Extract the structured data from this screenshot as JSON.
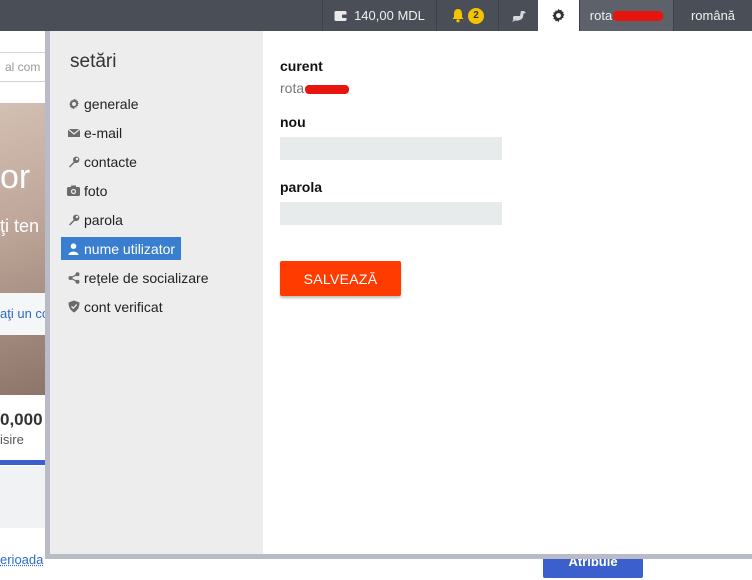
{
  "topbar": {
    "balance": "140,00 MDL",
    "notifications_count": "2",
    "user_prefix": "rota",
    "language": "română",
    "icons": [
      "wallet-icon",
      "bell-icon",
      "bird-icon",
      "gear-icon"
    ]
  },
  "background": {
    "search_placeholder": "al com",
    "hero_big": "or",
    "hero_sub": "ţi ten",
    "hero_link": "aţi un co",
    "price": "0,000 .",
    "label": "isire",
    "periods_link": "erioada",
    "button": "Atribuie"
  },
  "settings": {
    "title": "setări",
    "nav": [
      {
        "label": "generale",
        "icon": "gear-icon"
      },
      {
        "label": "e-mail",
        "icon": "envelope-icon"
      },
      {
        "label": "contacte",
        "icon": "wrench-icon"
      },
      {
        "label": "foto",
        "icon": "camera-icon"
      },
      {
        "label": "parola",
        "icon": "wrench-icon"
      },
      {
        "label": "nume utilizator",
        "icon": "user-icon",
        "active": true
      },
      {
        "label": "rețele de socializare",
        "icon": "share-icon"
      },
      {
        "label": "cont verificat",
        "icon": "shield-icon"
      }
    ],
    "form": {
      "current_label": "curent",
      "current_value": "rota",
      "new_label": "nou",
      "new_value": "",
      "password_label": "parola",
      "password_value": "",
      "save_label": "SALVEAZĂ"
    }
  },
  "colors": {
    "topbar": "#4a4f57",
    "accent_active": "#3a7fcf",
    "save_button": "#ff3b00",
    "badge": "#f5c400"
  }
}
